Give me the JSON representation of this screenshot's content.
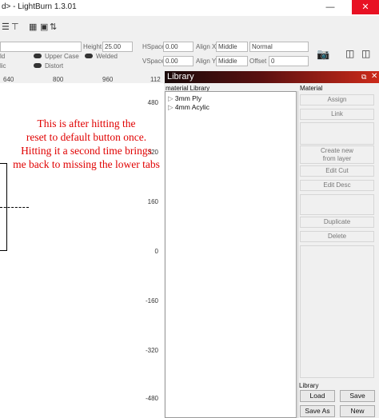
{
  "window": {
    "title": "d> - LightBurn 1.3.01"
  },
  "options": {
    "height_label": "Height",
    "height_value": "25.00",
    "hspace_label": "HSpace",
    "hspace_value": "0.00",
    "vspace_label": "VSpace",
    "vspace_value": "0.00",
    "alignx_label": "Align X",
    "alignx_value": "Middle",
    "aligny_label": "Align Y",
    "aligny_value": "Middle",
    "style_value": "Normal",
    "offset_label": "Offset",
    "offset_value": "0",
    "bold_label": "ld",
    "italic_label": "lic",
    "uppercase_label": "Upper Case",
    "welded_label": "Welded",
    "distort_label": "Distort"
  },
  "ruler": {
    "x_ticks": [
      "640",
      "800",
      "960",
      "112"
    ],
    "y_ticks": [
      "480",
      "320",
      "160",
      "0",
      "-160",
      "-320",
      "-480"
    ]
  },
  "annotation": {
    "lines": [
      "This is after hitting the",
      "reset to default button once.",
      "Hitting it a second time brings",
      "me back to missing the lower tabs"
    ]
  },
  "library": {
    "title": "Library",
    "tree_header": "material Library",
    "materials": [
      "3mm Ply",
      "4mm Acylic"
    ],
    "material_group_label": "Material",
    "buttons": {
      "assign": "Assign",
      "link": "Link",
      "create_new": "Create new\nfrom layer",
      "edit_cut": "Edit Cut",
      "edit_desc": "Edit Desc",
      "duplicate": "Duplicate",
      "delete": "Delete"
    },
    "library_group_label": "Library",
    "load": "Load",
    "save": "Save",
    "save_as": "Save As",
    "new": "New"
  }
}
